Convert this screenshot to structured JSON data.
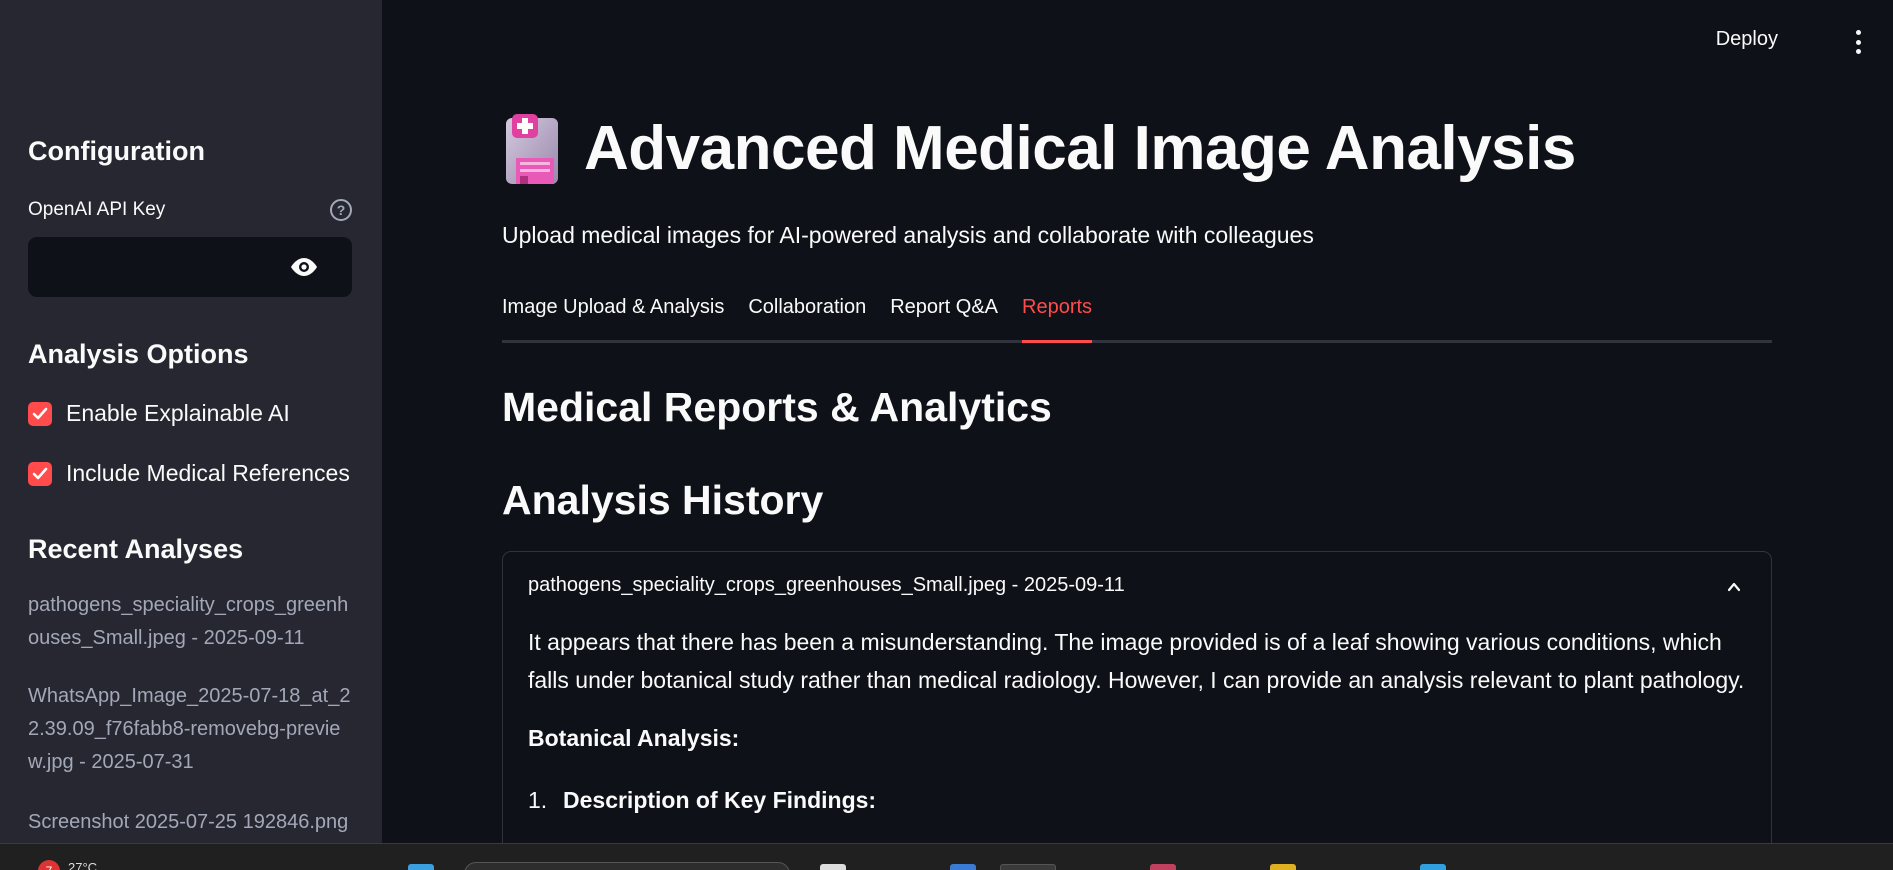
{
  "sidebar": {
    "config_title": "Configuration",
    "api_key_label": "OpenAI API Key",
    "api_key_value": "",
    "options_title": "Analysis Options",
    "options": [
      {
        "label": "Enable Explainable AI",
        "checked": true
      },
      {
        "label": "Include Medical References",
        "checked": true
      }
    ],
    "recent_title": "Recent Analyses",
    "recent": [
      "pathogens_speciality_crops_greenhouses_Small.jpeg - 2025-09-11",
      "WhatsApp_Image_2025-07-18_at_22.39.09_f76fabb8-removebg-preview.jpg - 2025-07-31",
      "Screenshot 2025-07-25 192846.png -"
    ]
  },
  "header": {
    "deploy_label": "Deploy",
    "menu_icon": "kebab-menu-icon"
  },
  "main": {
    "title": "Advanced Medical Image Analysis",
    "title_icon": "hospital-icon",
    "subtitle": "Upload medical images for AI-powered analysis and collaborate with colleagues",
    "tabs": [
      {
        "label": "Image Upload & Analysis",
        "active": false
      },
      {
        "label": "Collaboration",
        "active": false
      },
      {
        "label": "Report Q&A",
        "active": false
      },
      {
        "label": "Reports",
        "active": true
      }
    ],
    "section_title": "Medical Reports & Analytics",
    "history_title": "Analysis History",
    "expander": {
      "header": "pathogens_speciality_crops_greenhouses_Small.jpeg - 2025-09-11",
      "paragraph": "It appears that there has been a misunderstanding. The image provided is of a leaf showing various conditions, which falls under botanical study rather than medical radiology. However, I can provide an analysis relevant to plant pathology.",
      "bold_heading": "Botanical Analysis:",
      "list_number": "1.",
      "list_item": "Description of Key Findings:"
    }
  },
  "taskbar": {
    "badge": "7",
    "temperature": "27°C"
  },
  "colors": {
    "accent": "#ff4b4b",
    "sidebar_bg": "#262730",
    "main_bg": "#0e1117"
  }
}
